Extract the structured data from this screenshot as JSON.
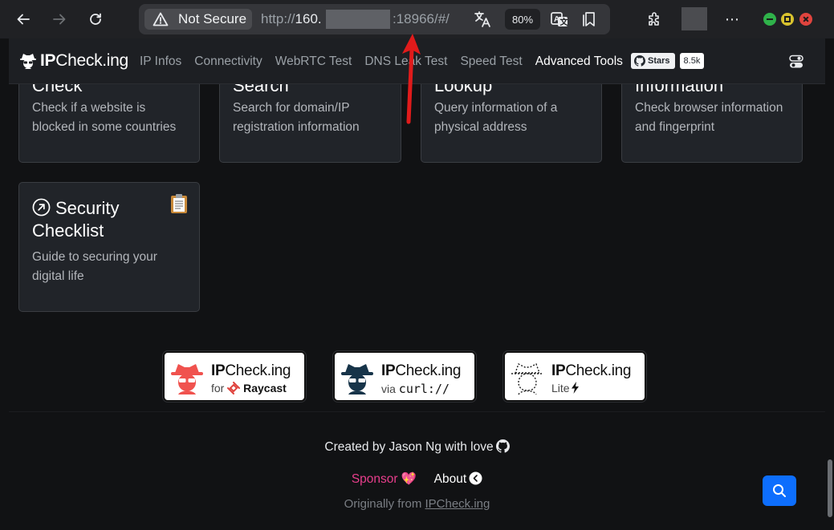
{
  "browser": {
    "security_label": "Not Secure",
    "url_prefix": "http://",
    "url_host": "160.",
    "url_port_path": ":18966/#/",
    "zoom": "80%"
  },
  "header": {
    "brand_prefix": "IP",
    "brand_suffix": "Check.ing",
    "nav": [
      "IP Infos",
      "Connectivity",
      "WebRTC Test",
      "DNS Leak Test",
      "Speed Test",
      "Advanced Tools"
    ],
    "github_stars_label": "Stars",
    "github_stars_count": "8.5k"
  },
  "cards": {
    "censorship": {
      "title": "Check",
      "desc": "Check if a website is blocked in some countries"
    },
    "whois": {
      "title": "Search",
      "desc": "Search for domain/IP registration information"
    },
    "map": {
      "title": "Lookup",
      "desc": "Query information of a physical address"
    },
    "browser": {
      "title": "Information",
      "desc": "Check browser information and fingerprint"
    },
    "security": {
      "title": "Security Checklist",
      "desc": "Guide to securing your digital life"
    }
  },
  "promos": {
    "raycast": {
      "title_bold": "IP",
      "title_rest": "Check.ing",
      "sub_prefix": "for",
      "sub_name": "Raycast"
    },
    "curl": {
      "title_bold": "IP",
      "title_rest": "Check.ing",
      "sub_prefix": "via",
      "sub_name": "curl://"
    },
    "lite": {
      "title_bold": "IP",
      "title_rest": "Check.ing",
      "sub_prefix": "Lite"
    }
  },
  "footer": {
    "credit": "Created by Jason Ng with love",
    "sponsor": "Sponsor 💖",
    "about": "About",
    "origin_prefix": "Originally from ",
    "origin_link": "IPCheck.ing"
  },
  "colors": {
    "accent_blue": "#0d6efd",
    "sponsor_pink": "#e83e8c",
    "annotation_red": "#e01b1b"
  }
}
